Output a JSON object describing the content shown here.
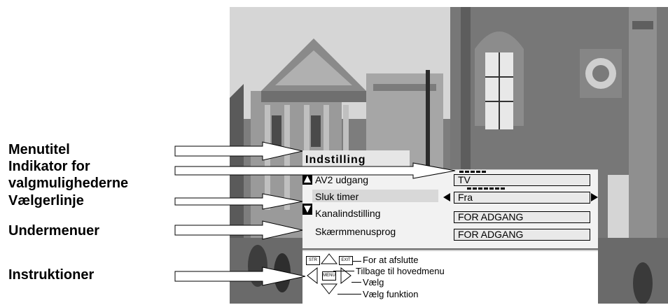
{
  "callouts": {
    "menutitel": "Menutitel",
    "indikator_line1": "Indikator for",
    "indikator_line2": "valgmulighederne",
    "vaelgerlinje": "Vælgerlinje",
    "undermenuer": "Undermenuer",
    "instruktioner": "Instruktioner"
  },
  "menu": {
    "title": "Indstilling",
    "rows": [
      {
        "label": "AV2 udgang",
        "value": "TV"
      },
      {
        "label": "Sluk timer",
        "value": "Fra"
      },
      {
        "label": "Kanalindstilling",
        "value": "FOR ADGANG"
      },
      {
        "label": "Skærmmenusprog",
        "value": "FOR ADGANG"
      }
    ]
  },
  "instructions": {
    "exit": "For at afslutte",
    "back": "Tilbage til hovedmenu",
    "select": "Vælg",
    "select_function": "Vælg funktion",
    "btn_str": "STR",
    "btn_menu": "MENU",
    "btn_exit": "EXIT"
  },
  "colors": {
    "menu_bg": "#f2f2f2",
    "selected_row": "#d8d8d8",
    "value_box": "#e9e9e9"
  }
}
